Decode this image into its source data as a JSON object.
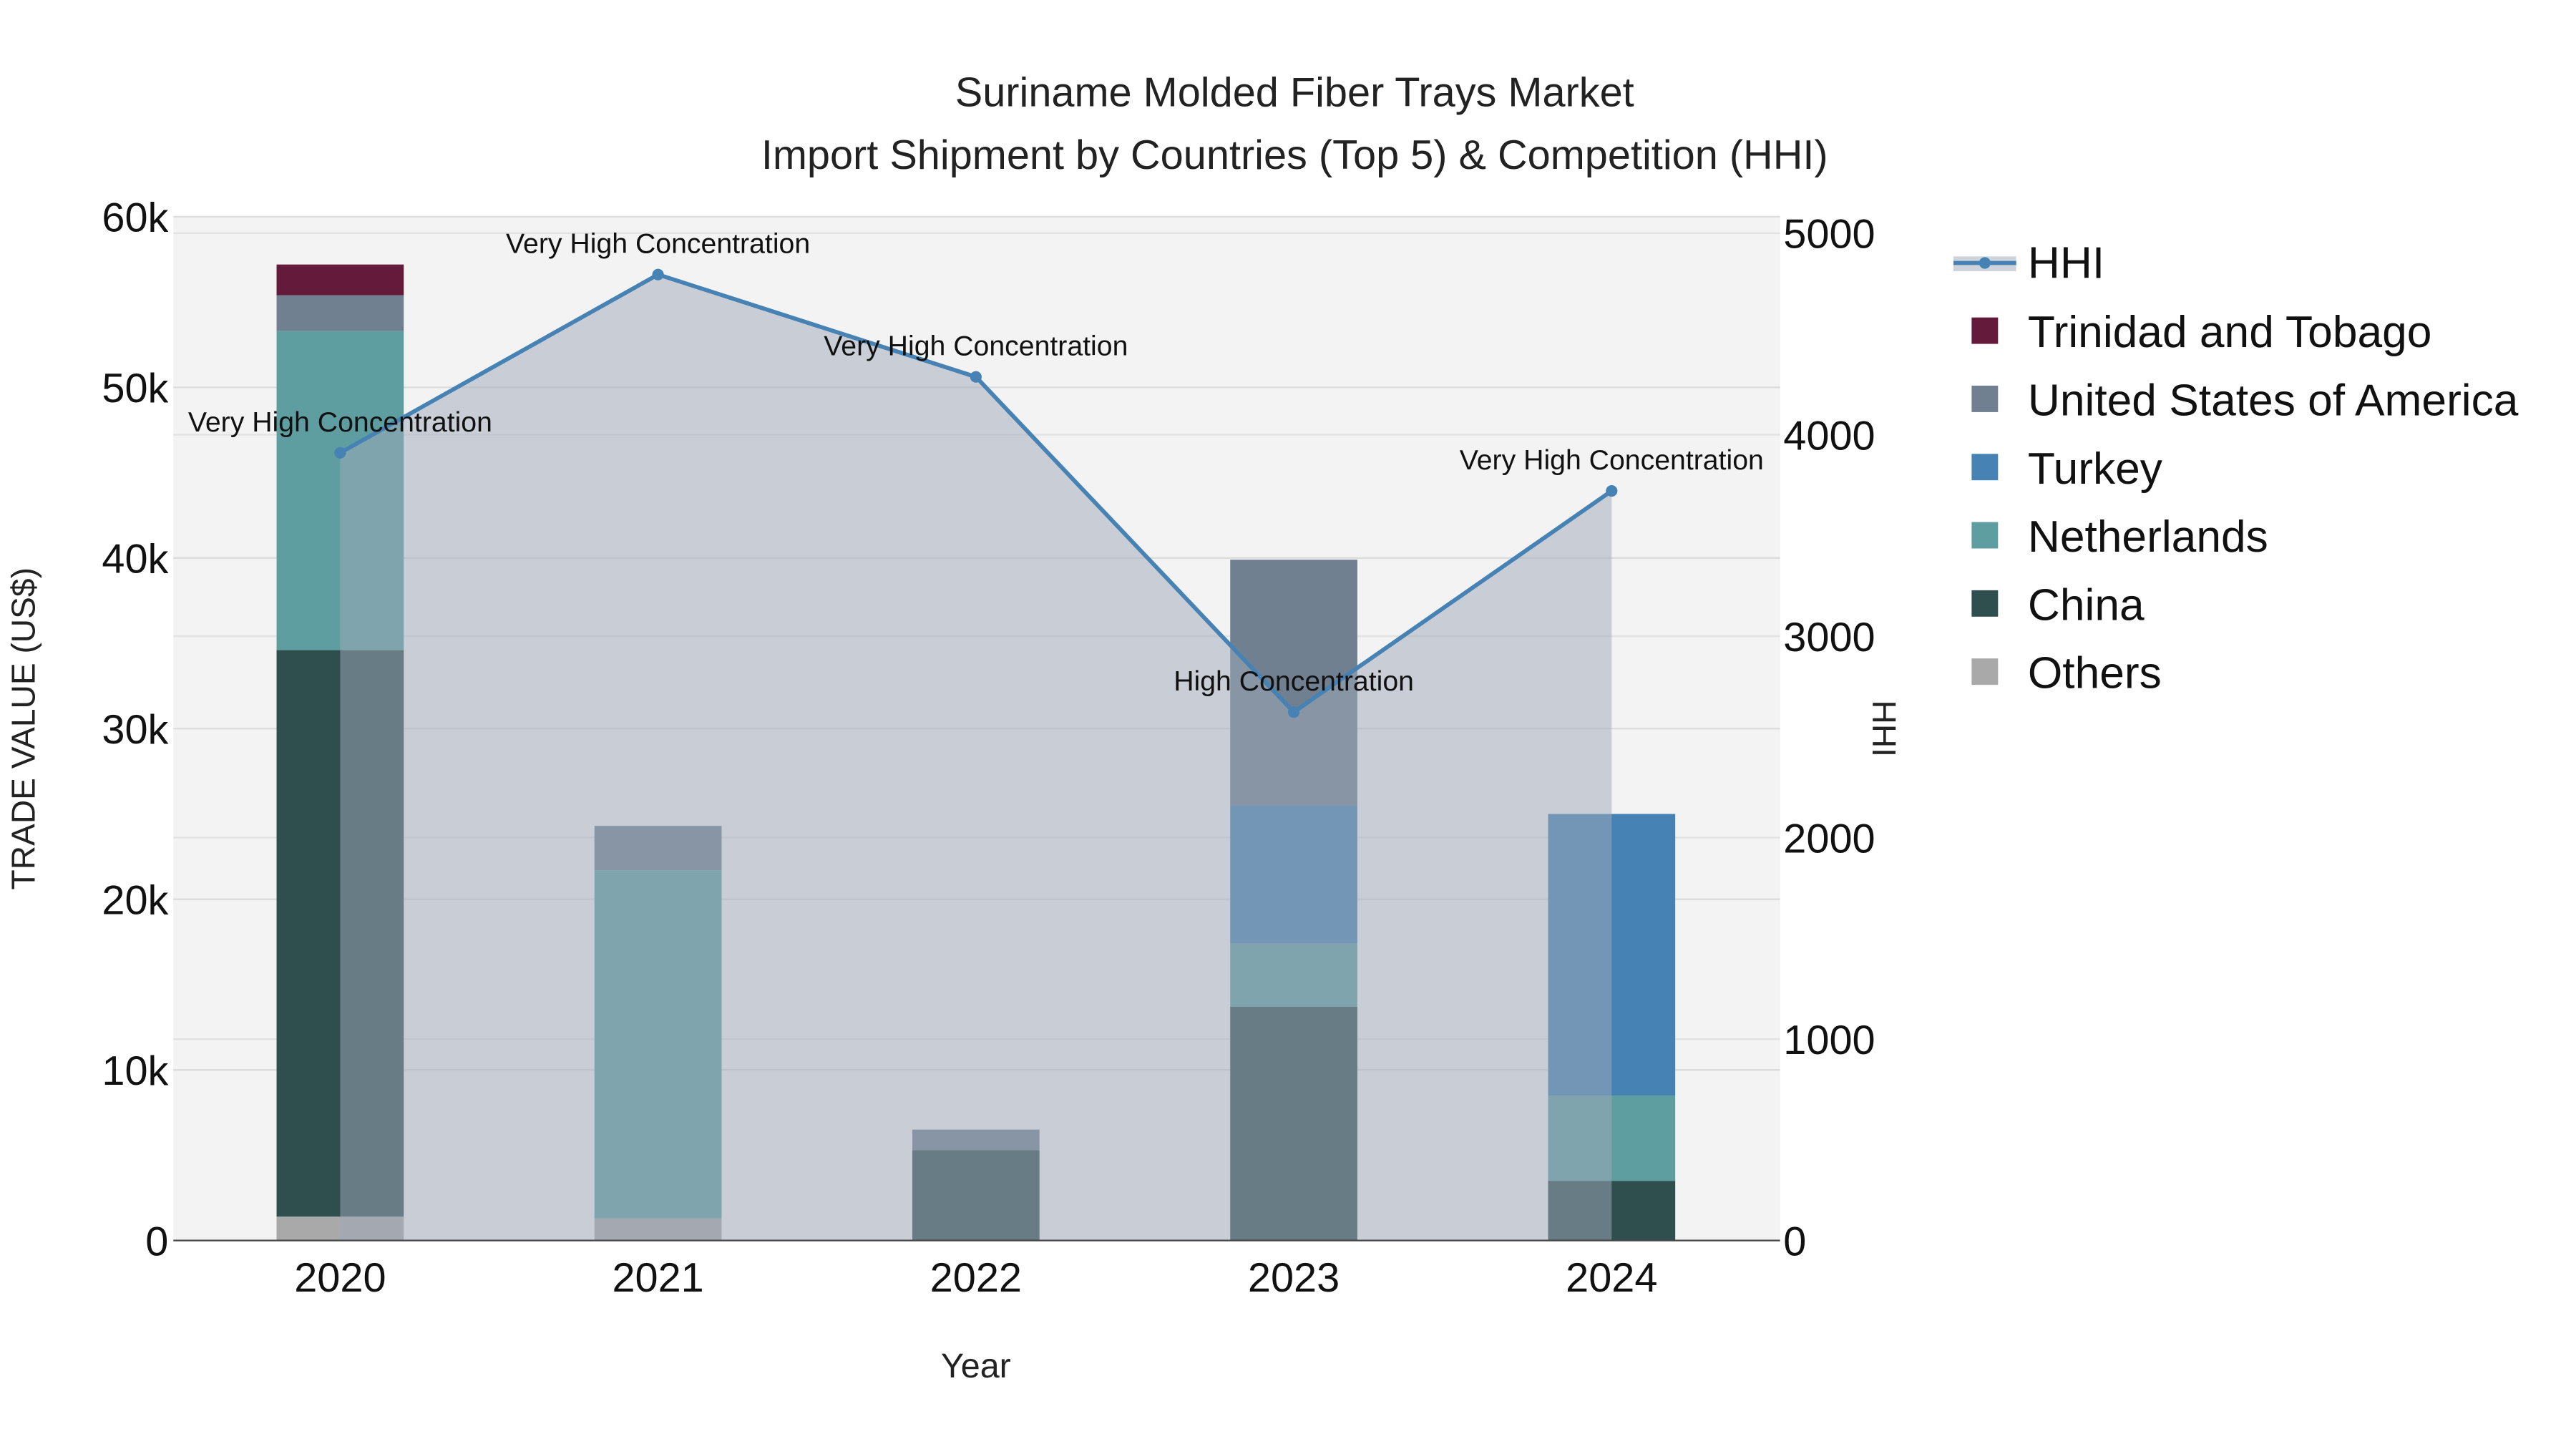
{
  "chart_data": {
    "type": "bar",
    "title": "Suriname Molded Fiber Trays Market",
    "subtitle": "Import Shipment by Countries (Top 5) & Competition (HHI)",
    "xlabel": "Year",
    "ylabel": "TRADE VALUE (US$)",
    "y2label": "HHI",
    "categories": [
      "2020",
      "2021",
      "2022",
      "2023",
      "2024"
    ],
    "ylim": [
      0,
      60000
    ],
    "y2lim": [
      0,
      5000
    ],
    "yticks": [
      {
        "v": 0,
        "label": "0"
      },
      {
        "v": 10000,
        "label": "10k"
      },
      {
        "v": 20000,
        "label": "20k"
      },
      {
        "v": 30000,
        "label": "30k"
      },
      {
        "v": 40000,
        "label": "40k"
      },
      {
        "v": 50000,
        "label": "50k"
      },
      {
        "v": 60000,
        "label": "60k"
      }
    ],
    "y2ticks": [
      {
        "v": 0,
        "label": "0"
      },
      {
        "v": 1000,
        "label": "1000"
      },
      {
        "v": 2000,
        "label": "2000"
      },
      {
        "v": 3000,
        "label": "3000"
      },
      {
        "v": 4000,
        "label": "4000"
      },
      {
        "v": 5000,
        "label": "5000"
      }
    ],
    "grid": true,
    "legend_placement": "right",
    "stack_order": [
      "Others",
      "China",
      "Netherlands",
      "Turkey",
      "United States of America",
      "Trinidad and Tobago"
    ],
    "series": [
      {
        "name": "Trinidad and Tobago",
        "color": "#641a3a",
        "values": [
          1800,
          0,
          0,
          0,
          0
        ]
      },
      {
        "name": "United States of America",
        "color": "#708090",
        "values": [
          2100,
          2600,
          1200,
          14400,
          0
        ]
      },
      {
        "name": "Turkey",
        "color": "#4682b4",
        "values": [
          0,
          0,
          0,
          8100,
          16500
        ]
      },
      {
        "name": "Netherlands",
        "color": "#5f9ea0",
        "values": [
          18700,
          20400,
          0,
          3700,
          5000
        ]
      },
      {
        "name": "China",
        "color": "#2f4f4f",
        "values": [
          33200,
          0,
          5300,
          13700,
          3500
        ]
      },
      {
        "name": "Others",
        "color": "#a9a9a9",
        "values": [
          1400,
          1300,
          0,
          0,
          0
        ]
      }
    ],
    "hhi": {
      "name": "HHI",
      "color": "#4682b4",
      "values": [
        3910,
        4795,
        4287,
        2623,
        3721
      ],
      "annotations": [
        "Very High Concentration",
        "Very High Concentration",
        "Very High Concentration",
        "High Concentration",
        "Very High Concentration"
      ]
    }
  }
}
